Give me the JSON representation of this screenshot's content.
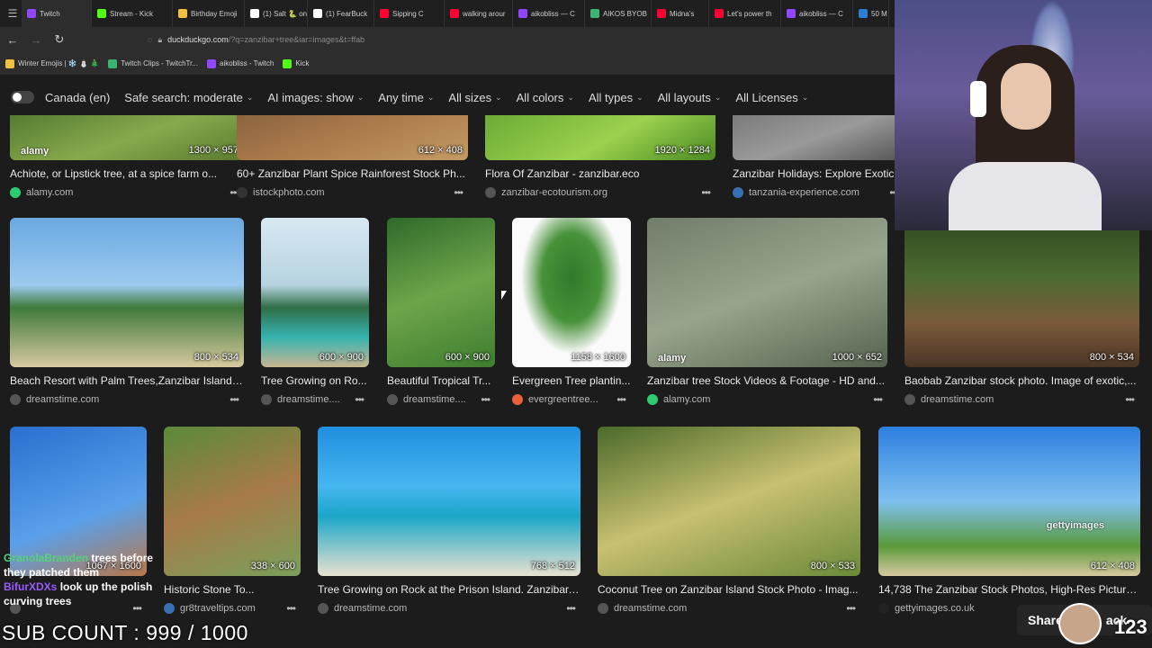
{
  "tabs": [
    {
      "label": "Twitch",
      "color": "#9146ff"
    },
    {
      "label": "Stream - Kick",
      "color": "#53fc18"
    },
    {
      "label": "Birthday Emoji",
      "color": "#f0c040"
    },
    {
      "label": "(1) Salt 🐍 on",
      "color": "#ffffff"
    },
    {
      "label": "(1) FearBuck",
      "color": "#ffffff"
    },
    {
      "label": "Sipping C",
      "color": "#ff0033"
    },
    {
      "label": "walking arour",
      "color": "#ff0033"
    },
    {
      "label": "aikobliss — C",
      "color": "#9146ff"
    },
    {
      "label": "AIKOS BYOB",
      "color": "#3cb371"
    },
    {
      "label": "Midna's",
      "color": "#ff0033"
    },
    {
      "label": "Let's power th",
      "color": "#ff0033"
    },
    {
      "label": "aikobliss — C",
      "color": "#9146ff"
    },
    {
      "label": "50 M",
      "color": "#2d7dd2"
    }
  ],
  "address": {
    "host": "duckduckgo.com",
    "path": "/?q=zanzibar+tree&iar=images&t=ffab"
  },
  "bookmarks": [
    {
      "label": "Winter Emojis | ❄️ ⛄ 🎄",
      "color": "#f0c040"
    },
    {
      "label": "Twitch Clips - TwitchTr...",
      "color": "#3cb371"
    },
    {
      "label": "aikobliss - Twitch",
      "color": "#9146ff"
    },
    {
      "label": "Kick",
      "color": "#53fc18"
    }
  ],
  "filters": {
    "region": "Canada (en)",
    "safe_search": "Safe search: moderate",
    "ai_images": "AI images: show",
    "time": "Any time",
    "sizes": "All sizes",
    "colors": "All colors",
    "types": "All types",
    "layouts": "All layouts",
    "licenses": "All Licenses"
  },
  "row1": [
    {
      "title": "Achiote, or Lipstick tree, at a spice farm o...",
      "dims": "1300 × 957",
      "source": "alamy.com",
      "icon_color": "#2ecc71",
      "wm": "alamy"
    },
    {
      "title": "60+ Zanzibar Plant Spice Rainforest Stock Ph...",
      "dims": "612 × 408",
      "source": "istockphoto.com",
      "icon_color": "#333333",
      "wm": ""
    },
    {
      "title": "Flora Of Zanzibar - zanzibar.eco",
      "dims": "1920 × 1284",
      "source": "zanzibar-ecotourism.org",
      "icon_color": "#555555",
      "wm": ""
    },
    {
      "title": "Zanzibar Holidays: Explore Exotic",
      "dims": "",
      "source": "tanzania-experience.com",
      "icon_color": "#3a6fb0",
      "wm": ""
    }
  ],
  "row2": [
    {
      "title": "Beach Resort with Palm Trees,Zanzibar Island,...",
      "dims": "800 × 534",
      "source": "dreamstime.com",
      "icon_color": "#555555",
      "wm": ""
    },
    {
      "title": "Tree Growing on Ro...",
      "dims": "600 × 900",
      "source": "dreamstime....",
      "icon_color": "#555555",
      "wm": ""
    },
    {
      "title": "Beautiful Tropical Tr...",
      "dims": "600 × 900",
      "source": "dreamstime....",
      "icon_color": "#555555",
      "wm": ""
    },
    {
      "title": "Evergreen Tree plantin...",
      "dims": "1158 × 1600",
      "source": "evergreentree...",
      "icon_color": "#e8613a",
      "wm": ""
    },
    {
      "title": "Zanzibar tree Stock Videos & Footage - HD and...",
      "dims": "1000 × 652",
      "source": "alamy.com",
      "icon_color": "#2ecc71",
      "wm": "alamy"
    },
    {
      "title": "Baobab Zanzibar stock photo. Image of exotic,...",
      "dims": "800 × 534",
      "source": "dreamstime.com",
      "icon_color": "#555555",
      "wm": ""
    }
  ],
  "row3": [
    {
      "title": "",
      "dims": "1067 × 1600",
      "source": "",
      "icon_color": "#555555",
      "wm": ""
    },
    {
      "title": "Historic Stone To...",
      "dims": "338 × 600",
      "source": "gr8traveltips.com",
      "icon_color": "#3a6fb0",
      "wm": ""
    },
    {
      "title": "Tree Growing on Rock at the Prison Island. Zanzibar, ...",
      "dims": "768 × 512",
      "source": "dreamstime.com",
      "icon_color": "#555555",
      "wm": ""
    },
    {
      "title": "Coconut Tree on Zanzibar Island Stock Photo - Imag...",
      "dims": "800 × 533",
      "source": "dreamstime.com",
      "icon_color": "#555555",
      "wm": ""
    },
    {
      "title": "14,738 The Zanzibar Stock Photos, High-Res Picture...",
      "dims": "612 × 408",
      "source": "gettyimages.co.uk",
      "icon_color": "#222222",
      "wm": "gettyimages"
    }
  ],
  "overlay": {
    "chat_line1_user": "GranolaBranden",
    "chat_line1_text": "trees before",
    "chat_line2": "they patched them",
    "chat_line3_user": "BifurXDXs",
    "chat_line3_text": "look up the polish",
    "chat_line4": "curving trees",
    "sub_count": "SUB COUNT : 999 / 1000",
    "share_label": "Share",
    "share_suffix": "ack",
    "number": "123"
  }
}
